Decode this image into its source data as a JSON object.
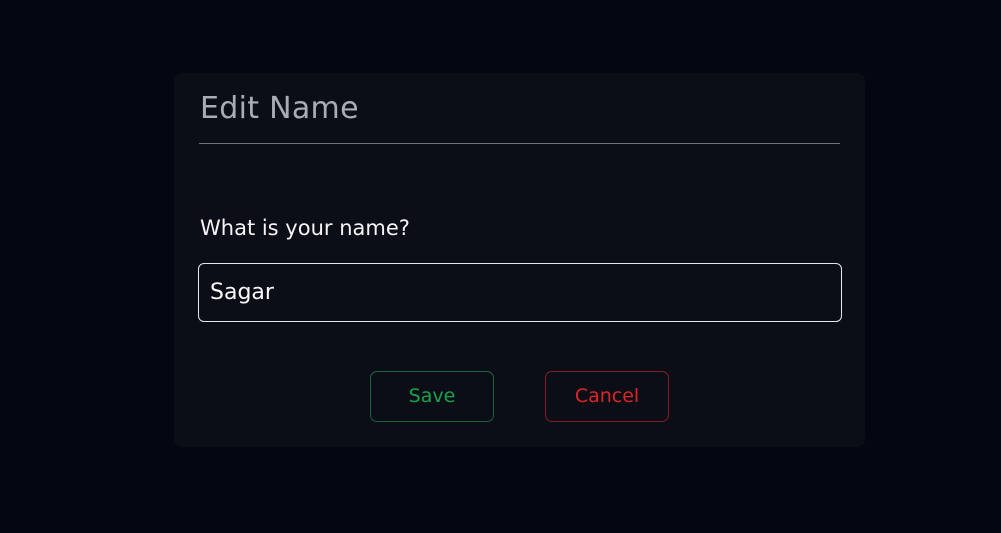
{
  "modal": {
    "title": "Edit Name",
    "field_label": "What is your name?",
    "input_value": "Sagar",
    "save_label": "Save",
    "cancel_label": "Cancel"
  },
  "colors": {
    "background": "#030712",
    "modal_background": "#0b0e17",
    "save": "#16a34a",
    "cancel": "#dc2626"
  }
}
